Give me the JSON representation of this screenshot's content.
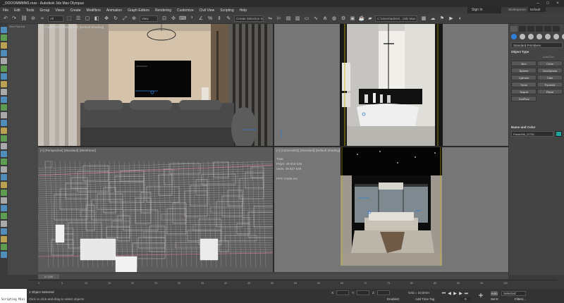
{
  "window": {
    "title": "_OOOOMMMM1.max - Autodesk 3ds Max Olympus"
  },
  "menu": [
    "File",
    "Edit",
    "Tools",
    "Group",
    "Views",
    "Create",
    "Modifiers",
    "Animation",
    "Graph Editors",
    "Rendering",
    "Customize",
    "Civil View",
    "Scripting",
    "Help"
  ],
  "account": {
    "signin": "Sign In",
    "workspaces_label": "Workspaces:",
    "workspace": "Default"
  },
  "toolbar": {
    "filter": "All",
    "view": "View",
    "selection_set": "Create Selection Set",
    "project_path": "C:\\Users\\admin\\...\\3ds Max 2024"
  },
  "scene_explorer": {
    "label": "View Plus Inst"
  },
  "viewports": {
    "top_left": {
      "label": "[+] [Camera001] [Standard] [Default Shading]"
    },
    "top_right": {
      "label": ""
    },
    "bottom_left": {
      "label": "[+] [Perspective] [Standard] [Wireframe]"
    },
    "bottom_right": {
      "label": "[+] [Camera002] [Standard] [Default Shading]"
    },
    "stats": {
      "total": "Total",
      "polys": "Polys:  49 815 528",
      "verts": "Verts:  38 927 649",
      "fps": "FPS:    0.826 ms"
    }
  },
  "command_panel": {
    "autodesk": "Autodesk",
    "category": "Standard Primitives",
    "object_type": "Object Type",
    "autogrid": "AutoGrid",
    "primitives": [
      "Box",
      "Cone",
      "Sphere",
      "GeoSphere",
      "Cylinder",
      "Tube",
      "Torus",
      "Pyramid",
      "Teapot",
      "Plane",
      "TextPlus"
    ],
    "name_color": "Name and Color",
    "object_name": "Plane006_22781"
  },
  "timeline": {
    "slider": "0 / 100",
    "ticks": [
      "0",
      "5",
      "10",
      "15",
      "20",
      "25",
      "30",
      "35",
      "40",
      "45",
      "50",
      "55",
      "60",
      "65",
      "70",
      "75",
      "80",
      "85",
      "90",
      "95",
      "100"
    ]
  },
  "status": {
    "maxscript": "Scripting Mini",
    "selected": "1 Object Selected",
    "prompt": "Click or click-and-drag to select objects",
    "x_label": "X:",
    "y_label": "Y:",
    "z_label": "Z:",
    "grid": "Grid = 10,0mm",
    "enabled": "Enabled:",
    "add_time_tag": "Add Time Tag",
    "auto": "Auto",
    "selected_dd": "Selected",
    "setk": "Set K",
    "filters": "Filters...",
    "frame": "0"
  },
  "colors": {
    "accent_blue": "#2d7fd8",
    "object_color": "#1fa59d",
    "viewport_bg": "#3e3e3e"
  }
}
